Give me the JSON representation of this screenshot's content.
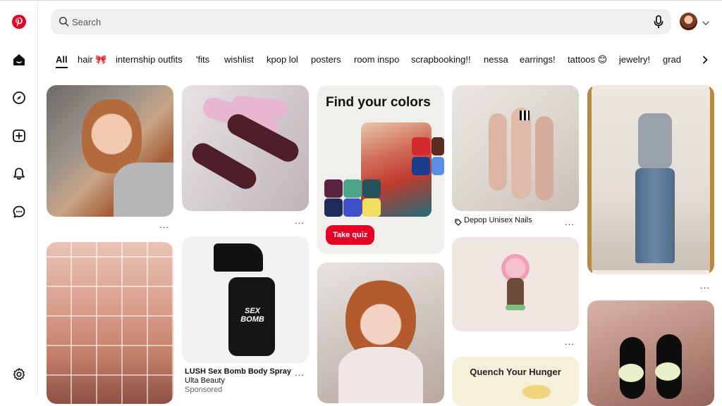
{
  "search": {
    "placeholder": "Search"
  },
  "chips": [
    {
      "label": "All",
      "active": true
    },
    {
      "label": "hair 🎀"
    },
    {
      "label": "internship outfits"
    },
    {
      "label": "'fits"
    },
    {
      "label": "wishlist"
    },
    {
      "label": "kpop lol"
    },
    {
      "label": "posters"
    },
    {
      "label": "room inspo"
    },
    {
      "label": "scrapbooking!!"
    },
    {
      "label": "nessa"
    },
    {
      "label": "earrings!"
    },
    {
      "label": "tattoos 😊"
    },
    {
      "label": "jewelry!"
    },
    {
      "label": "grad"
    }
  ],
  "pins": {
    "colors": {
      "headline": "Find your colors",
      "button": "Take quiz"
    },
    "nails": {
      "title": "Depop Unisex Nails"
    },
    "lush": {
      "title": "LUSH Sex Bomb Body Spray",
      "brand": "Ulta Beauty",
      "sponsored": "Sponsored"
    },
    "hunger": {
      "headline": "Quench Your Hunger"
    },
    "more": "..."
  },
  "colors": {
    "brand": "#e60023",
    "search_bg": "#efefef"
  }
}
